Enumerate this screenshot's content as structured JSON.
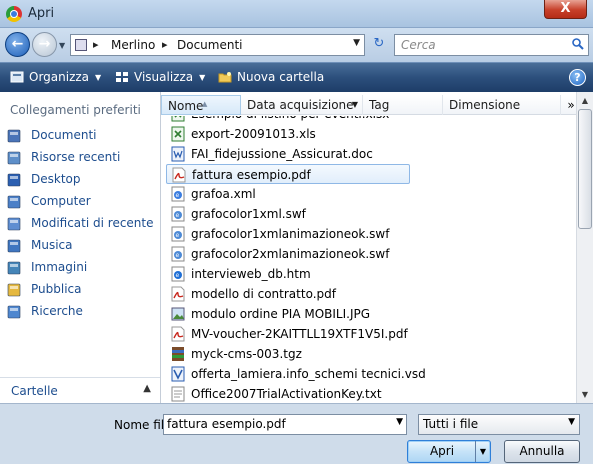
{
  "window": {
    "title": "Apri",
    "close_glyph": "X"
  },
  "address": {
    "crumbs": [
      "Merlino",
      "Documenti"
    ],
    "search_placeholder": "Cerca"
  },
  "toolbar": {
    "organize": "Organizza",
    "views": "Visualizza",
    "new_folder": "Nuova cartella",
    "help": "?"
  },
  "nav": {
    "header": "Collegamenti preferiti",
    "items": [
      {
        "label": "Documenti",
        "icon": "documents-icon",
        "color": "#4a74b8"
      },
      {
        "label": "Risorse recenti",
        "icon": "recent-icon",
        "color": "#5e8fc9"
      },
      {
        "label": "Desktop",
        "icon": "desktop-icon",
        "color": "#2b5fb1"
      },
      {
        "label": "Computer",
        "icon": "computer-icon",
        "color": "#4b7fc7"
      },
      {
        "label": "Modificati di recente",
        "icon": "recent-changes-icon",
        "color": "#5f8ed1"
      },
      {
        "label": "Musica",
        "icon": "music-icon",
        "color": "#3f76c0"
      },
      {
        "label": "Immagini",
        "icon": "pictures-icon",
        "color": "#4585b8"
      },
      {
        "label": "Pubblica",
        "icon": "public-folder-icon",
        "color": "#e5b83f"
      },
      {
        "label": "Ricerche",
        "icon": "searches-icon",
        "color": "#4f87cf"
      }
    ],
    "footer": "Cartelle"
  },
  "columns": [
    "Nome",
    "Data acquisizione",
    "Tag",
    "Dimensione"
  ],
  "columns_more": "»",
  "files": [
    {
      "name": "Esempio di listino per eventi.xlsx",
      "type": "excel"
    },
    {
      "name": "export-20091013.xls",
      "type": "excel"
    },
    {
      "name": "FAI_fidejussione_Assicurat.doc",
      "type": "word"
    },
    {
      "name": "fattura esempio.pdf",
      "type": "pdf",
      "selected": true
    },
    {
      "name": "grafoa.xml",
      "type": "xml"
    },
    {
      "name": "grafocolor1xml.swf",
      "type": "swf"
    },
    {
      "name": "grafocolor1xmlanimazioneok.swf",
      "type": "swf"
    },
    {
      "name": "grafocolor2xmlanimazioneok.swf",
      "type": "swf"
    },
    {
      "name": "intervieweb_db.htm",
      "type": "html"
    },
    {
      "name": "modello di contratto.pdf",
      "type": "pdf"
    },
    {
      "name": "modulo ordine PIA MOBILI.JPG",
      "type": "image"
    },
    {
      "name": "MV-voucher-2KAITTLL19XTF1V5I.pdf",
      "type": "pdf"
    },
    {
      "name": "myck-cms-003.tgz",
      "type": "archive"
    },
    {
      "name": "offerta_lamiera.info_schemi tecnici.vsd",
      "type": "visio"
    },
    {
      "name": "Office2007TrialActivationKey.txt",
      "type": "text"
    }
  ],
  "bottom": {
    "filename_label": "Nome file:",
    "filename_value": "fattura esempio.pdf",
    "filetype_value": "Tutti i file",
    "open_label": "Apri",
    "cancel_label": "Annulla"
  }
}
